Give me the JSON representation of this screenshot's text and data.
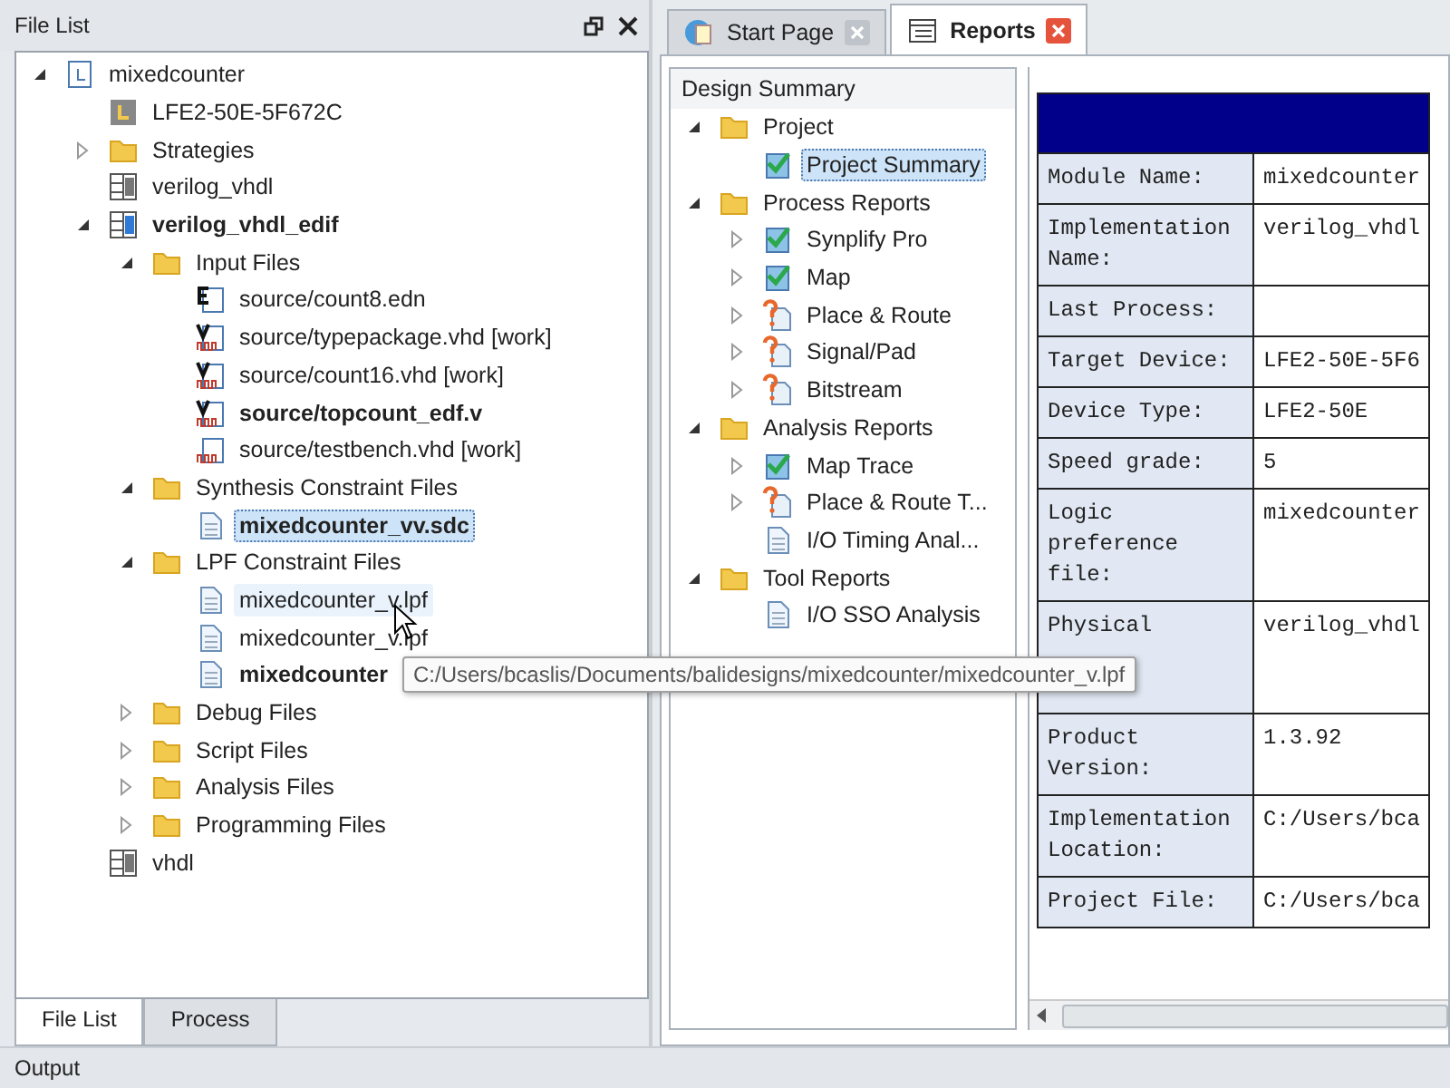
{
  "file_list": {
    "title": "File List",
    "tree": [
      {
        "label": "mixedcounter",
        "kind": "project",
        "expanded": true,
        "children": [
          {
            "label": "LFE2-50E-5F672C",
            "kind": "chip"
          },
          {
            "label": "Strategies",
            "kind": "folder",
            "expanded": false
          },
          {
            "label": "verilog_vhdl",
            "kind": "impl"
          },
          {
            "label": "verilog_vhdl_edif",
            "kind": "impl-active",
            "bold": true,
            "expanded": true,
            "children": [
              {
                "label": "Input Files",
                "kind": "folder",
                "expanded": true,
                "children": [
                  {
                    "label": "source/count8.edn",
                    "kind": "edif"
                  },
                  {
                    "label": "source/typepackage.vhd [work]",
                    "kind": "hdl"
                  },
                  {
                    "label": "source/count16.vhd [work]",
                    "kind": "hdl"
                  },
                  {
                    "label": "source/topcount_edf.v",
                    "kind": "hdl",
                    "bold": true
                  },
                  {
                    "label": "source/testbench.vhd [work]",
                    "kind": "hdl-sim"
                  }
                ]
              },
              {
                "label": "Synthesis Constraint Files",
                "kind": "folder",
                "expanded": true,
                "children": [
                  {
                    "label": "mixedcounter_vv.sdc",
                    "kind": "doc",
                    "bold": true,
                    "selected": true
                  }
                ]
              },
              {
                "label": "LPF Constraint Files",
                "kind": "folder",
                "expanded": true,
                "children": [
                  {
                    "label": "mixedcounter_v.lpf",
                    "kind": "doc",
                    "hover": true
                  },
                  {
                    "label": "mixedcounter_v.lpf",
                    "kind": "doc"
                  },
                  {
                    "label": "mixedcounter",
                    "kind": "doc",
                    "bold": true
                  }
                ]
              },
              {
                "label": "Debug Files",
                "kind": "folder",
                "expanded": false
              },
              {
                "label": "Script Files",
                "kind": "folder",
                "expanded": false
              },
              {
                "label": "Analysis Files",
                "kind": "folder",
                "expanded": false
              },
              {
                "label": "Programming Files",
                "kind": "folder",
                "expanded": false
              }
            ]
          },
          {
            "label": "vhdl",
            "kind": "impl"
          }
        ]
      }
    ],
    "bottom_tabs": [
      {
        "label": "File List",
        "selected": true
      },
      {
        "label": "Process",
        "selected": false
      }
    ]
  },
  "doc_tabs": [
    {
      "label": "Start Page",
      "kind": "start",
      "selected": false
    },
    {
      "label": "Reports",
      "kind": "report",
      "selected": true
    }
  ],
  "design_summary": {
    "title": "Design Summary",
    "tree": [
      {
        "label": "Project",
        "kind": "folder",
        "expanded": true,
        "children": [
          {
            "label": "Project Summary",
            "kind": "ok",
            "selected": true
          }
        ]
      },
      {
        "label": "Process Reports",
        "kind": "folder",
        "expanded": true,
        "children": [
          {
            "label": "Synplify Pro",
            "kind": "ok",
            "expanded": false
          },
          {
            "label": "Map",
            "kind": "ok",
            "expanded": false
          },
          {
            "label": "Place & Route",
            "kind": "unknown",
            "expanded": false
          },
          {
            "label": "Signal/Pad",
            "kind": "unknown",
            "expanded": false
          },
          {
            "label": "Bitstream",
            "kind": "unknown",
            "expanded": false
          }
        ]
      },
      {
        "label": "Analysis Reports",
        "kind": "folder",
        "expanded": true,
        "children": [
          {
            "label": "Map Trace",
            "kind": "ok",
            "expanded": false
          },
          {
            "label": "Place & Route T...",
            "kind": "unknown",
            "expanded": false
          },
          {
            "label": "I/O Timing Anal...",
            "kind": "plain"
          }
        ]
      },
      {
        "label": "Tool Reports",
        "kind": "folder",
        "expanded": true,
        "children": [
          {
            "label": "I/O SSO Analysis",
            "kind": "plain"
          }
        ]
      }
    ]
  },
  "summary_table": {
    "rows": [
      {
        "label": "Module Name:",
        "value": "mixedcounter"
      },
      {
        "label": "Implementation Name:",
        "value": "verilog_vhdl"
      },
      {
        "label": "Last Process:",
        "value": ""
      },
      {
        "label": "Target Device:",
        "value": "LFE2-50E-5F6"
      },
      {
        "label": "Device Type:",
        "value": "LFE2-50E"
      },
      {
        "label": "Speed grade:",
        "value": "5"
      },
      {
        "label": "Logic preference file:",
        "value": "mixedcounter"
      },
      {
        "label": "Physical",
        "value": "verilog_vhdl",
        "covered": true
      },
      {
        "label": "Product Version:",
        "value": "1.3.92"
      },
      {
        "label": "Implementation Location:",
        "value": "C:/Users/bca"
      },
      {
        "label": "Project File:",
        "value": "C:/Users/bca"
      }
    ]
  },
  "tooltip": "C:/Users/bcaslis/Documents/balidesigns/mixedcounter/mixedcounter_v.lpf",
  "output_bar": {
    "title": "Output"
  }
}
